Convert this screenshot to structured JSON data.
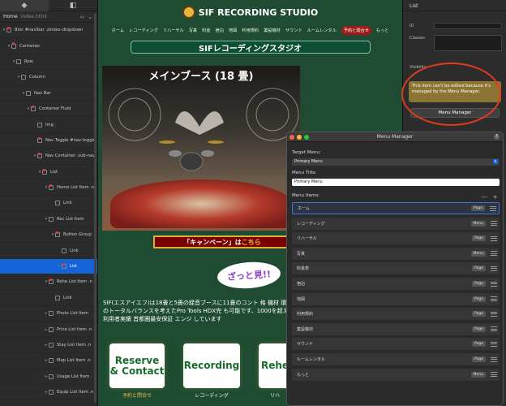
{
  "navigator": {
    "tabs": [
      "◆",
      "◧"
    ],
    "file": {
      "name": "Home",
      "sub": "index.html"
    },
    "items": [
      {
        "label": "Bloc #navibar .zindex-dropdown",
        "arrow": "▾"
      },
      {
        "label": "Container",
        "arrow": "▾"
      },
      {
        "label": "Row",
        "arrow": "▾"
      },
      {
        "label": "Column",
        "arrow": "▾"
      },
      {
        "label": "Nav Bar",
        "arrow": "▾"
      },
      {
        "label": "Container Fluid",
        "arrow": "▾"
      },
      {
        "label": "Img",
        "arrow": ""
      },
      {
        "label": "Nav Toggle #nav-toggle",
        "arrow": ""
      },
      {
        "label": "Nav Container .sub-nav",
        "arrow": "▾"
      },
      {
        "label": "List",
        "arrow": "▾"
      },
      {
        "label": "Home List Item .n",
        "arrow": "▾"
      },
      {
        "label": "Link",
        "arrow": ""
      },
      {
        "label": "Rec List Item",
        "arrow": "▾"
      },
      {
        "label": "Button Group",
        "arrow": "▾"
      },
      {
        "label": "Link",
        "arrow": ""
      },
      {
        "label": "List",
        "arrow": "▸"
      },
      {
        "label": "Rehe List Item .n",
        "arrow": "▾"
      },
      {
        "label": "Link",
        "arrow": ""
      },
      {
        "label": "Photo List Item",
        "arrow": "▸"
      },
      {
        "label": "Price List Item .n",
        "arrow": "▸"
      },
      {
        "label": "Stay List Item .n",
        "arrow": "▸"
      },
      {
        "label": "Map List Item .n",
        "arrow": "▸"
      },
      {
        "label": "Usage List Item .",
        "arrow": "▸"
      },
      {
        "label": "Equip List Item .n",
        "arrow": "▸"
      }
    ]
  },
  "site": {
    "brand": "SIF RECORDING STUDIO",
    "menu": [
      "ホーム",
      "レコーディング",
      "リハーサル",
      "写真",
      "料金",
      "宿泊",
      "地図",
      "利用規約",
      "業設機材",
      "サウンド",
      "ルームレンタル",
      "予約と問合せ",
      "もっと"
    ],
    "banner": "SIFレコーディングスタジオ",
    "photo_title": "メインブース (18 畳)",
    "campaign_a": "「キャンペーン」は",
    "campaign_b": "こちら",
    "bubble": "ざっと見!!",
    "intro": "SIF(エスアイエフ)は18畳と5畳の録音ブースに11畳のコント 格 機材 環境のトータルバランスを考えたPro Tools HDX完 も可能です、1000を超える利用者実績 首都圏最安保証 エンジ しています",
    "cards": [
      {
        "title": "Reserve & Contact",
        "caption": "予約と問合せ"
      },
      {
        "title": "Recording",
        "caption": "レコーディング"
      },
      {
        "title": "Rehe",
        "caption": "リハ"
      }
    ],
    "colors": {
      "bg": "#1f4b33",
      "campaign": "#7a0000",
      "gold": "#d8b13b"
    }
  },
  "inspector": {
    "title": "List",
    "id_label": "ID",
    "classes_label": "Classes",
    "visibility_label": "Visibility",
    "notice": "This item can't be edited because it's managed by the Menu Manager.",
    "menu_manager_button": "Menu Manager"
  },
  "menu_manager": {
    "title": "Menu Manager",
    "target_label": "Target Menu:",
    "target_value": "Primary Menu",
    "menu_title_label": "Menu Title:",
    "menu_title_value": "Primary Menu",
    "items_label": "Menu Items:",
    "minus": "—",
    "plus": "+",
    "items": [
      {
        "label": "ホーム",
        "type": "Page"
      },
      {
        "label": "レコーディング",
        "type": "Menu"
      },
      {
        "label": "リハーサル",
        "type": "Page"
      },
      {
        "label": "写真",
        "type": "Menu"
      },
      {
        "label": "料金表",
        "type": "Page"
      },
      {
        "label": "宿泊",
        "type": "Page"
      },
      {
        "label": "地図",
        "type": "Page"
      },
      {
        "label": "利用規約",
        "type": "Page"
      },
      {
        "label": "業設機材",
        "type": "Page"
      },
      {
        "label": "サウンド",
        "type": "Page"
      },
      {
        "label": "ルームレンタル",
        "type": "Page"
      },
      {
        "label": "もっと",
        "type": "Menu"
      }
    ]
  }
}
